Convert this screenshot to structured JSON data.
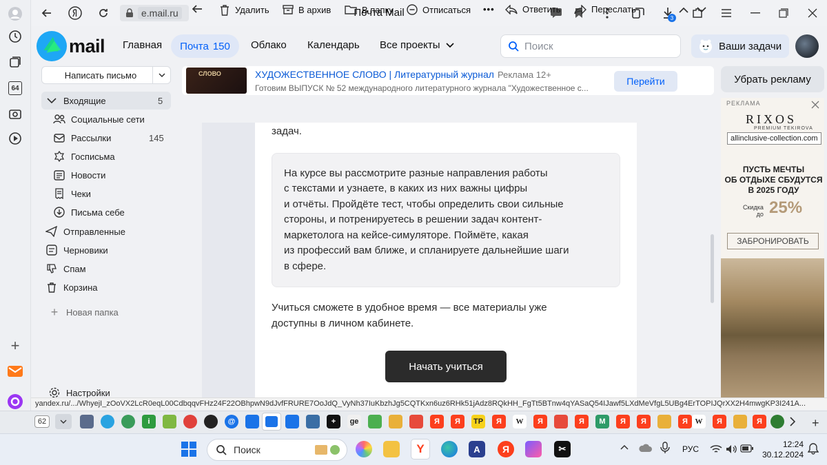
{
  "browser": {
    "domain": "e.mail.ru",
    "page_title": "Почта Mail",
    "downloads_badge": "3",
    "status_url": "yandex.ru/.../WhyejI_zOoVX2LcR0eqL00CdbqqvFHz24F22OBhpwN9dJvfFRURE7OoJdQ_VyNh37IuKbzhJg5CQTKxn6uz6RHk51jAdz8RQkHH_FgTt5BTnw4qYASaQ54IJawf5LXdMeVfgL5UBg4ErTOPIJQrXX2H4mwgKP3I241A..."
  },
  "left_bar": {
    "tile_label": "64"
  },
  "mail": {
    "logo_text": "mail",
    "nav": {
      "home": "Главная",
      "mail": "Почта",
      "mail_count": "150",
      "cloud": "Облако",
      "calendar": "Календарь",
      "all_projects": "Все проекты"
    },
    "search_placeholder": "Поиск",
    "tasks_label": "Ваши задачи",
    "compose_label": "Написать письмо",
    "folders": [
      {
        "label": "Входящие",
        "count": "5"
      },
      {
        "label": "Социальные сети",
        "count": ""
      },
      {
        "label": "Рассылки",
        "count": "145"
      },
      {
        "label": "Госписьма",
        "count": ""
      },
      {
        "label": "Новости",
        "count": ""
      },
      {
        "label": "Чеки",
        "count": ""
      },
      {
        "label": "Письма себе",
        "count": ""
      },
      {
        "label": "Отправленные",
        "count": ""
      },
      {
        "label": "Черновики",
        "count": ""
      },
      {
        "label": "Спам",
        "count": ""
      },
      {
        "label": "Корзина",
        "count": ""
      }
    ],
    "new_folder_label": "Новая папка",
    "settings_label": "Настройки"
  },
  "banner": {
    "image_text": "СЛОВО",
    "title": "ХУДОЖЕСТВЕННОЕ СЛОВО | Литературный журнал",
    "ad_label": "Реклама 12+",
    "subtitle": "Готовим ВЫПУСК № 52 международного литературного журнала \"Художественное с...",
    "button": "Перейти"
  },
  "toolbar": {
    "delete": "Удалить",
    "archive": "В архив",
    "to_folder": "В папку",
    "unsubscribe": "Отписаться",
    "more": "•••",
    "reply": "Ответить",
    "forward": "Переслать"
  },
  "letter": {
    "top_fragment": "задач.",
    "quote_lines": [
      "На курсе вы рассмотрите разные направления работы",
      "с текстами и узнаете, в каких из них важны цифры",
      "и отчёты. Пройдёте тест, чтобы определить свои сильные",
      "стороны, и потренируетесь в решении задач контент-",
      "маркетолога на кейсе-симуляторе. Поймёте, какая",
      "из профессий вам ближе, и спланируете дальнейшие шаги",
      "в сфере."
    ],
    "body_lines": [
      "Учиться сможете в удобное время — все материалы уже",
      "доступны в личном кабинете."
    ],
    "cta": "Начать учиться"
  },
  "right_ad": {
    "remove_ads": "Убрать рекламу",
    "ad_label": "РЕКЛАМА",
    "brand": "RIXOS",
    "brand_sub": "PREMIUM TEKIROVA",
    "tooltip": "allinclusive-collection.com",
    "headline_lines": [
      "ПУСТЬ МЕЧТЫ",
      "ОБ ОТДЫХЕ СБУДУТСЯ",
      "В 2025 ГОДУ"
    ],
    "discount_label_1": "Скидка",
    "discount_label_2": "до",
    "discount_value": "25%",
    "book_button": "ЗАБРОНИРОВАТЬ"
  },
  "tabs": {
    "count_badge": "62"
  },
  "taskbar": {
    "search_label": "Поиск",
    "lang": "РУС",
    "time": "12:24",
    "date": "30.12.2024"
  },
  "colors": {
    "accent_blue": "#005ff9",
    "yandex_red": "#fc3f1d",
    "cta_dark": "#2b2b2b"
  }
}
